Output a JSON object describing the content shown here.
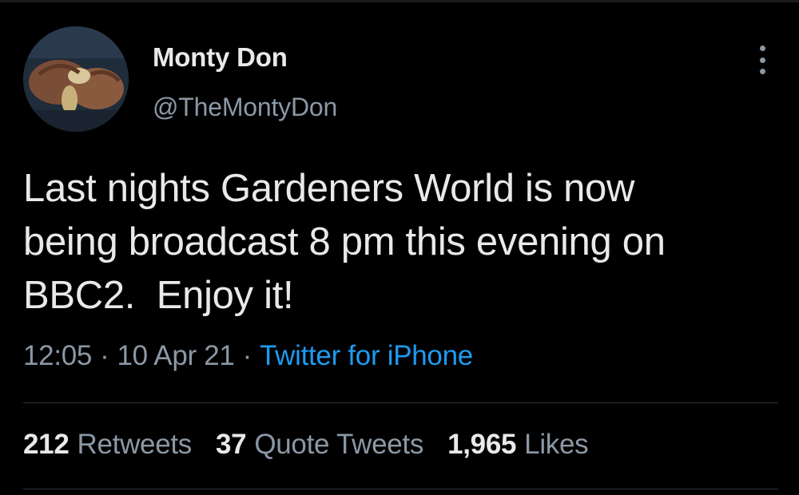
{
  "author": {
    "display_name": "Monty Don",
    "handle": "@TheMontyDon",
    "avatar_icon": "avatar-hands-bulb"
  },
  "more_icon": "more-vertical-icon",
  "tweet": {
    "text": "Last nights Gardeners World is now\nbeing broadcast 8 pm this evening on\nBBC2.  Enjoy it!"
  },
  "meta": {
    "time": "12:05",
    "separator": "·",
    "date": "10 Apr 21",
    "source": "Twitter for iPhone"
  },
  "stats": {
    "retweets": {
      "count": "212",
      "label": "Retweets"
    },
    "quotes": {
      "count": "37",
      "label": "Quote Tweets"
    },
    "likes": {
      "count": "1,965",
      "label": "Likes"
    }
  },
  "colors": {
    "background": "#000000",
    "text_primary": "#e7e9ea",
    "text_secondary": "#8b98a5",
    "link": "#1d9bf0",
    "divider": "#2f3336"
  }
}
